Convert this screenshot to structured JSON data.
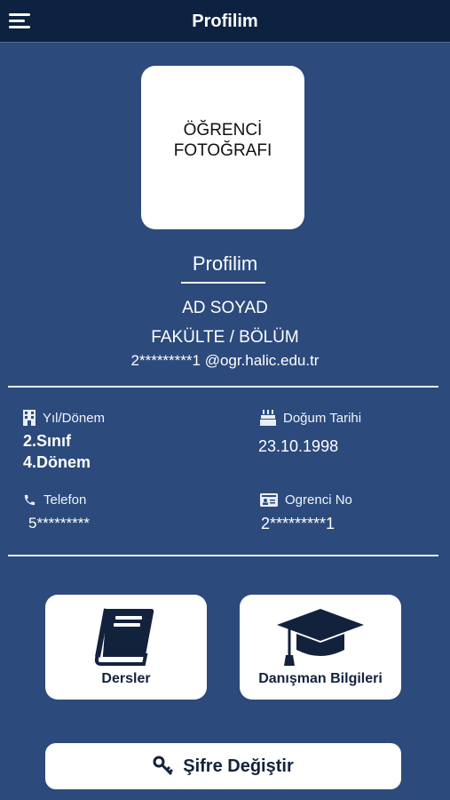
{
  "header": {
    "title": "Profilim",
    "menu_icon": "hamburger-menu-icon"
  },
  "profile": {
    "photo_placeholder": "ÖĞRENCİ\nFOTOĞRAFI",
    "section_title": "Profilim",
    "name": "AD SOYAD",
    "faculty": "FAKÜLTE / BÖLÜM",
    "email": "2*********1 @ogr.halic.edu.tr"
  },
  "info": {
    "year": {
      "label": "Yıl/Dönem",
      "value_line1": "2.Sınıf",
      "value_line2": "4.Dönem",
      "icon": "building-icon"
    },
    "birth": {
      "label": "Doğum Tarihi",
      "value": "23.10.1998",
      "icon": "cake-icon"
    },
    "phone": {
      "label": "Telefon",
      "value": "5*********",
      "icon": "phone-icon"
    },
    "student_no": {
      "label": "Ogrenci No",
      "value": "2*********1",
      "icon": "id-card-icon"
    }
  },
  "cards": {
    "courses": {
      "label": "Dersler",
      "icon": "book-icon"
    },
    "advisor": {
      "label": "Danışman Bilgileri",
      "icon": "graduation-cap-icon"
    }
  },
  "password_button": {
    "label": "Şifre Değiştir",
    "icon": "key-icon"
  },
  "colors": {
    "background": "#2c4a7c",
    "topbar": "#0d2240",
    "card": "#ffffff",
    "icon_dark": "#13223c"
  }
}
